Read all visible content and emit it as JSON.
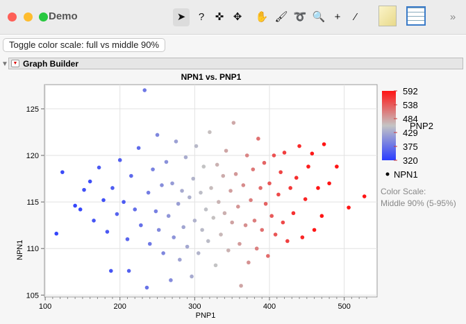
{
  "window": {
    "title": "Demo"
  },
  "toolbar": {
    "tools": [
      "arrow-icon",
      "help-icon",
      "selection-icon",
      "crosshair-move-icon",
      "hand-icon",
      "brush-icon",
      "lasso-icon",
      "magnifier-icon",
      "crosshair-icon",
      "ruler-icon",
      "journal-icon",
      "data-table-icon",
      "overflow-chevron-icon"
    ],
    "tool_glyphs": [
      "➤",
      "?",
      "✜",
      "✥",
      "✋",
      "🖌",
      "➰",
      "🔍",
      "+",
      "⁄",
      "",
      "",
      " »"
    ]
  },
  "button": {
    "toggle_label": "Toggle color scale: full vs middle 90%"
  },
  "report": {
    "title": "Graph Builder"
  },
  "colors": {
    "low": "#2a3cff",
    "mid": "#c4c4c4",
    "high": "#ff1414"
  },
  "chart_data": {
    "type": "scatter",
    "title": "NPN1 vs. PNP1",
    "xlabel": "PNP1",
    "ylabel": "NPN1",
    "xlim": [
      99,
      544
    ],
    "ylim": [
      104.8,
      127.6
    ],
    "xticks": [
      "100",
      "200",
      "300",
      "400",
      "500"
    ],
    "yticks": [
      "105",
      "110",
      "115",
      "120",
      "125"
    ],
    "grid": true,
    "legend": {
      "color_title": "PNP2",
      "color_ticks": [
        "592",
        "538",
        "484",
        "429",
        "375",
        "320"
      ],
      "color_range": [
        320,
        592
      ],
      "marker_label": "NPN1",
      "note_line1": "Color Scale:",
      "note_line2": "Middle 90% (5-95%)",
      "placement": "right"
    },
    "points_xy_pnp2": [
      [
        115,
        111.6,
        330
      ],
      [
        123,
        118.2,
        335
      ],
      [
        140,
        114.6,
        330
      ],
      [
        147,
        114.2,
        332
      ],
      [
        152,
        116.3,
        340
      ],
      [
        160,
        117.2,
        338
      ],
      [
        165,
        113.0,
        345
      ],
      [
        172,
        118.7,
        350
      ],
      [
        178,
        115.2,
        340
      ],
      [
        183,
        111.8,
        348
      ],
      [
        188,
        107.6,
        345
      ],
      [
        190,
        116.5,
        352
      ],
      [
        196,
        113.7,
        360
      ],
      [
        200,
        119.5,
        355
      ],
      [
        205,
        115.0,
        350
      ],
      [
        210,
        111.0,
        362
      ],
      [
        212,
        107.6,
        358
      ],
      [
        215,
        117.8,
        365
      ],
      [
        220,
        114.2,
        370
      ],
      [
        225,
        120.8,
        368
      ],
      [
        228,
        112.5,
        372
      ],
      [
        233,
        127.0,
        380
      ],
      [
        236,
        105.8,
        375
      ],
      [
        238,
        116.0,
        385
      ],
      [
        240,
        110.5,
        380
      ],
      [
        244,
        118.5,
        390
      ],
      [
        248,
        114.0,
        388
      ],
      [
        250,
        122.2,
        395
      ],
      [
        252,
        112.0,
        398
      ],
      [
        256,
        116.8,
        402
      ],
      [
        258,
        109.5,
        395
      ],
      [
        262,
        119.3,
        405
      ],
      [
        265,
        113.5,
        410
      ],
      [
        268,
        106.6,
        400
      ],
      [
        270,
        117.0,
        415
      ],
      [
        272,
        111.2,
        408
      ],
      [
        275,
        121.5,
        420
      ],
      [
        278,
        114.8,
        418
      ],
      [
        280,
        108.8,
        422
      ],
      [
        283,
        116.2,
        430
      ],
      [
        285,
        112.3,
        425
      ],
      [
        288,
        119.8,
        432
      ],
      [
        290,
        110.2,
        428
      ],
      [
        293,
        115.5,
        436
      ],
      [
        296,
        107.0,
        430
      ],
      [
        298,
        117.5,
        440
      ],
      [
        300,
        113.0,
        438
      ],
      [
        302,
        121.0,
        445
      ],
      [
        305,
        109.5,
        440
      ],
      [
        308,
        116.0,
        450
      ],
      [
        310,
        112.0,
        446
      ],
      [
        312,
        118.8,
        455
      ],
      [
        315,
        114.2,
        452
      ],
      [
        318,
        110.8,
        448
      ],
      [
        320,
        122.5,
        460
      ],
      [
        322,
        116.5,
        462
      ],
      [
        325,
        113.3,
        458
      ],
      [
        328,
        108.2,
        455
      ],
      [
        330,
        119.0,
        470
      ],
      [
        332,
        115.0,
        468
      ],
      [
        335,
        111.5,
        465
      ],
      [
        338,
        117.8,
        475
      ],
      [
        340,
        113.8,
        472
      ],
      [
        342,
        120.5,
        480
      ],
      [
        345,
        109.8,
        470
      ],
      [
        348,
        116.2,
        485
      ],
      [
        350,
        112.8,
        482
      ],
      [
        352,
        123.5,
        478
      ],
      [
        355,
        118.0,
        490
      ],
      [
        358,
        114.5,
        492
      ],
      [
        360,
        110.5,
        488
      ],
      [
        362,
        106.0,
        480
      ],
      [
        365,
        116.8,
        500
      ],
      [
        368,
        112.5,
        498
      ],
      [
        370,
        120.0,
        505
      ],
      [
        372,
        108.5,
        495
      ],
      [
        375,
        115.2,
        510
      ],
      [
        378,
        118.5,
        515
      ],
      [
        380,
        113.0,
        512
      ],
      [
        383,
        110.0,
        508
      ],
      [
        385,
        121.8,
        520
      ],
      [
        388,
        116.5,
        525
      ],
      [
        390,
        112.0,
        522
      ],
      [
        393,
        119.2,
        530
      ],
      [
        395,
        114.8,
        532
      ],
      [
        398,
        109.2,
        525
      ],
      [
        400,
        117.0,
        540
      ],
      [
        403,
        113.5,
        538
      ],
      [
        406,
        120.0,
        545
      ],
      [
        408,
        111.5,
        542
      ],
      [
        412,
        115.8,
        550
      ],
      [
        415,
        118.2,
        555
      ],
      [
        418,
        112.8,
        552
      ],
      [
        420,
        120.3,
        560
      ],
      [
        424,
        110.8,
        558
      ],
      [
        428,
        116.5,
        565
      ],
      [
        432,
        113.8,
        570
      ],
      [
        436,
        117.6,
        572
      ],
      [
        440,
        121.0,
        575
      ],
      [
        444,
        111.2,
        578
      ],
      [
        448,
        115.3,
        580
      ],
      [
        452,
        118.8,
        585
      ],
      [
        457,
        120.2,
        588
      ],
      [
        460,
        112.0,
        590
      ],
      [
        465,
        116.5,
        592
      ],
      [
        470,
        113.5,
        592
      ],
      [
        473,
        121.2,
        592
      ],
      [
        480,
        117.0,
        592
      ],
      [
        490,
        118.8,
        592
      ],
      [
        506,
        114.4,
        592
      ],
      [
        527,
        115.6,
        592
      ]
    ]
  }
}
